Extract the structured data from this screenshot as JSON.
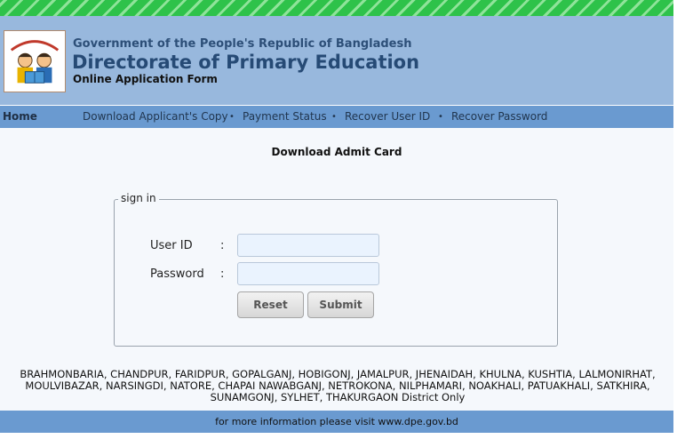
{
  "header": {
    "government": "Government of the People's Republic of Bangladesh",
    "department": "Directorate of Primary Education",
    "subtitle": "Online Application Form",
    "logo_icon": "dpe-logo-children-reading"
  },
  "nav": {
    "home": "Home",
    "links": [
      "Download Applicant's Copy",
      "Payment Status",
      "Recover User ID",
      "Recover Password"
    ],
    "separator": "•"
  },
  "main": {
    "title": "Download Admit Card",
    "signin": {
      "legend": "sign in",
      "user_id_label": "User ID",
      "password_label": "Password",
      "colon": ":",
      "user_id_value": "",
      "password_value": "",
      "reset_label": "Reset",
      "submit_label": "Submit"
    },
    "districts_line1": "BRAHMONBARIA, CHANDPUR, FARIDPUR, GOPALGANJ, HOBIGONJ, JAMALPUR, JHENAIDAH, KHULNA, KUSHTIA, LALMONIRHAT,",
    "districts_line2": "MOULVIBAZAR, NARSINGDI, NATORE, CHAPAI NAWABGANJ, NETROKONA, NILPHAMARI, NOAKHALI, PATUAKHALI, SATKHIRA,",
    "districts_line3": "SUNAMGONJ, SYLHET, THAKURGAON District Only"
  },
  "footer": {
    "text": "for more information please visit www.dpe.gov.bd"
  },
  "colors": {
    "header_bg": "#98b8dd",
    "nav_bg": "#6a9ad0",
    "title_blue": "#264a75",
    "stripe_green": "#2ec24a"
  }
}
